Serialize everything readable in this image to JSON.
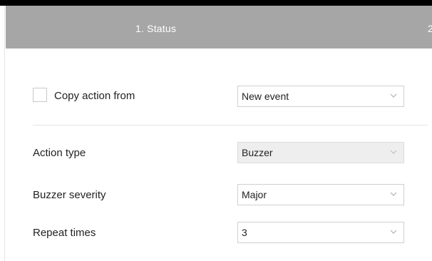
{
  "wizard": {
    "steps": [
      {
        "label": "1. Status"
      },
      {
        "label": "2"
      }
    ]
  },
  "form": {
    "copy_action": {
      "label": "Copy action from",
      "checked": false,
      "value": "New event"
    },
    "action_type": {
      "label": "Action type",
      "value": "Buzzer",
      "disabled": true
    },
    "buzzer_severity": {
      "label": "Buzzer severity",
      "value": "Major"
    },
    "repeat_times": {
      "label": "Repeat times",
      "value": "3"
    }
  },
  "icons": {
    "dropdown": "chevron-down-icon"
  }
}
